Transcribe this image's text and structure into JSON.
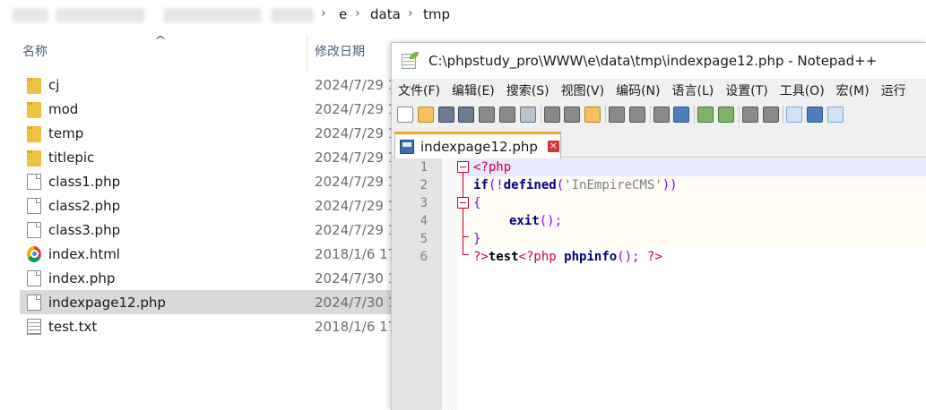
{
  "explorer": {
    "breadcrumb": [
      "e",
      "data",
      "tmp"
    ],
    "columns": {
      "name": "名称",
      "date": "修改日期"
    },
    "files": [
      {
        "name": "cj",
        "date": "2024/7/29 1",
        "type": "folder"
      },
      {
        "name": "mod",
        "date": "2024/7/29 1",
        "type": "folder"
      },
      {
        "name": "temp",
        "date": "2024/7/29 1",
        "type": "folder"
      },
      {
        "name": "titlepic",
        "date": "2024/7/29 1",
        "type": "folder"
      },
      {
        "name": "class1.php",
        "date": "2024/7/29 1",
        "type": "file"
      },
      {
        "name": "class2.php",
        "date": "2024/7/29 1",
        "type": "file"
      },
      {
        "name": "class3.php",
        "date": "2024/7/29 1",
        "type": "file"
      },
      {
        "name": "index.html",
        "date": "2018/1/6 17",
        "type": "chrome"
      },
      {
        "name": "index.php",
        "date": "2024/7/30 1",
        "type": "file"
      },
      {
        "name": "indexpage12.php",
        "date": "2024/7/30 1",
        "type": "file",
        "selected": true
      },
      {
        "name": "test.txt",
        "date": "2018/1/6 17",
        "type": "text"
      }
    ]
  },
  "notepad": {
    "title": "C:\\phpstudy_pro\\WWW\\e\\data\\tmp\\indexpage12.php - Notepad++",
    "menu": [
      "文件(F)",
      "编辑(E)",
      "搜索(S)",
      "视图(V)",
      "编码(N)",
      "语言(L)",
      "设置(T)",
      "工具(O)",
      "宏(M)",
      "运行"
    ],
    "tab": {
      "label": "indexpage12.php",
      "close_icon": "close-icon"
    },
    "line_numbers": [
      "1",
      "2",
      "3",
      "4",
      "5",
      "6"
    ],
    "code": {
      "l1_open": "<?php",
      "l2_if": "if",
      "l2_paren_open": "(!",
      "l2_defined": "defined",
      "l2_paren2": "(",
      "l2_str": "'InEmpireCMS'",
      "l2_close": "))",
      "l3_brace": "{",
      "l4_exit": "exit",
      "l4_tail": "();",
      "l5_brace": "}",
      "l6_close": "?>",
      "l6_text": "test",
      "l6_open": "<?php",
      "l6_fn": "phpinfo",
      "l6_tail": "();",
      "l6_end": "?>"
    }
  }
}
